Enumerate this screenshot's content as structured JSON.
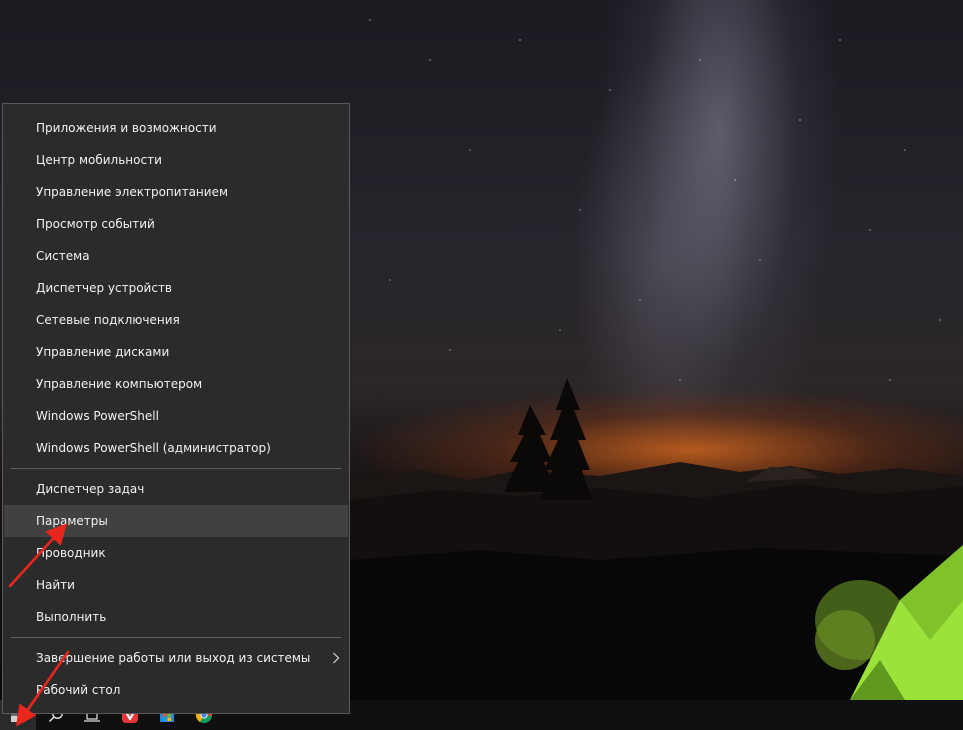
{
  "menu": {
    "group1": [
      {
        "id": "apps-features",
        "label": "Приложения и возможности"
      },
      {
        "id": "mobility-center",
        "label": "Центр мобильности"
      },
      {
        "id": "power-options",
        "label": "Управление электропитанием"
      },
      {
        "id": "event-viewer",
        "label": "Просмотр событий"
      },
      {
        "id": "system",
        "label": "Система"
      },
      {
        "id": "device-manager",
        "label": "Диспетчер устройств"
      },
      {
        "id": "network-connections",
        "label": "Сетевые подключения"
      },
      {
        "id": "disk-management",
        "label": "Управление дисками"
      },
      {
        "id": "computer-management",
        "label": "Управление компьютером"
      },
      {
        "id": "powershell",
        "label": "Windows PowerShell"
      },
      {
        "id": "powershell-admin",
        "label": "Windows PowerShell (администратор)"
      }
    ],
    "group2": [
      {
        "id": "task-manager",
        "label": "Диспетчер задач"
      },
      {
        "id": "settings",
        "label": "Параметры"
      },
      {
        "id": "explorer",
        "label": "Проводник"
      },
      {
        "id": "search",
        "label": "Найти"
      },
      {
        "id": "run",
        "label": "Выполнить"
      }
    ],
    "group3": [
      {
        "id": "shutdown-signout",
        "label": "Завершение работы или выход из системы"
      },
      {
        "id": "desktop",
        "label": "Рабочий стол"
      }
    ],
    "hovered_item": "settings",
    "submenu_item": "shutdown-signout"
  },
  "taskbar": {
    "icons": [
      "windows-start-icon",
      "search-icon",
      "task-view-icon",
      "vivaldi-icon",
      "store-icon",
      "chrome-icon"
    ]
  },
  "colors": {
    "menu_bg": "#2b2b2b",
    "menu_hover": "#414141",
    "menu_border": "#5a5a5a",
    "annotation_red": "#e8261c",
    "tent_green": "#9be23a"
  }
}
